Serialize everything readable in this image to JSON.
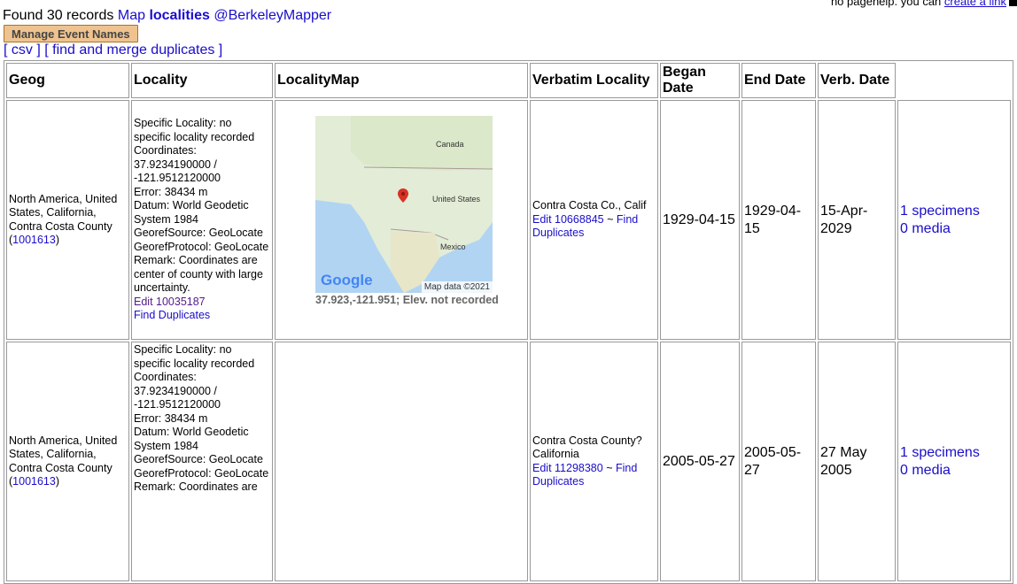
{
  "pagehelp": {
    "text": "no pagehelp. you can",
    "link": "create a link"
  },
  "header": {
    "found_prefix": "Found 30 records",
    "map_label": "Map",
    "localities_label": "localities",
    "berkeley_label": "@BerkeleyMapper"
  },
  "manage_button": "Manage Event Names",
  "links": {
    "csv": "[ csv ]",
    "duplicates": "[ find and merge duplicates ]"
  },
  "columns": [
    "Geog",
    "Locality",
    "LocalityMap",
    "Verbatim Locality",
    "Began Date",
    "End Date",
    "Verb. Date"
  ],
  "rows": [
    {
      "geog": "North America, United States, California, Contra Costa County",
      "geog_id": "1001613",
      "locality_lines": [
        "Specific Locality: no specific locality recorded",
        "Coordinates: 37.9234190000 / -121.9512120000",
        "Error: 38434 m",
        "Datum: World Geodetic System 1984",
        "GeorefSource: GeoLocate",
        "GeorefProtocol: GeoLocate",
        "Remark: Coordinates are center of county with large uncertainty."
      ],
      "edit_locality": "Edit 10035187",
      "find_duplicates": "Find Duplicates",
      "map_caption": "37.923,-121.951; Elev. not recorded",
      "map_labels": {
        "canada": "Canada",
        "us": "United States",
        "mexico": "Mexico"
      },
      "map_google": "Google",
      "map_data": "Map data ©2021",
      "verbatim": "Contra Costa Co., Calif",
      "edit_event": "Edit 10668845",
      "tilde": "~",
      "find_duplicates_event": "Find Duplicates",
      "began": "1929-04-15",
      "end": "1929-04-15",
      "verb_date": "15-Apr-2029",
      "specimens": "1 specimens",
      "media": "0 media"
    },
    {
      "geog": "North America, United States, California, Contra Costa County",
      "geog_id": "1001613",
      "locality_lines": [
        "Specific Locality: no specific locality recorded",
        "Coordinates: 37.9234190000 / -121.9512120000",
        "Error: 38434 m",
        "Datum: World Geodetic System 1984",
        "GeorefSource: GeoLocate",
        "GeorefProtocol: GeoLocate",
        "Remark: Coordinates are"
      ],
      "verbatim": "Contra Costa County? California",
      "edit_event": "Edit 11298380",
      "tilde": "~",
      "find_duplicates_event": "Find Duplicates",
      "began": "2005-05-27",
      "end": "2005-05-27",
      "verb_date": "27 May 2005",
      "specimens": "1 specimens",
      "media": "0 media"
    }
  ],
  "colors": {
    "button_bg": "#efc38f",
    "link": "#1a0dcc",
    "visited": "#551a8b",
    "map_water": "#b2d4f3",
    "pin": "#d93025"
  }
}
